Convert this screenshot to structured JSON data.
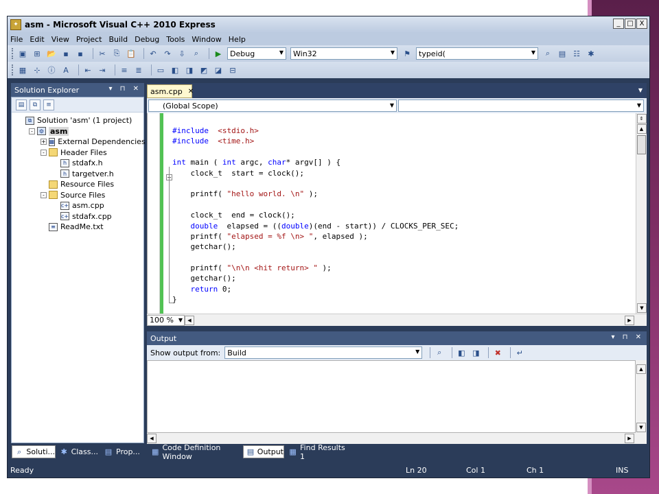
{
  "window": {
    "title": "asm - Microsoft Visual C++ 2010 Express",
    "controls": [
      "_",
      "□",
      "X"
    ]
  },
  "menu": [
    "File",
    "Edit",
    "View",
    "Project",
    "Build",
    "Debug",
    "Tools",
    "Window",
    "Help"
  ],
  "toolbar": {
    "config": "Debug",
    "platform": "Win32",
    "find_value": "typeid("
  },
  "solution_explorer": {
    "title": "Solution Explorer",
    "tree": [
      {
        "label": "Solution 'asm' (1 project)",
        "depth": 0,
        "icon": "solution-icon"
      },
      {
        "label": "asm",
        "depth": 1,
        "icon": "project-icon",
        "expander": "-",
        "bold": true
      },
      {
        "label": "External Dependencies",
        "depth": 2,
        "icon": "external-deps-icon",
        "expander": "+"
      },
      {
        "label": "Header Files",
        "depth": 2,
        "icon": "folder-icon",
        "expander": "-"
      },
      {
        "label": "stdafx.h",
        "depth": 3,
        "icon": "header-file-icon"
      },
      {
        "label": "targetver.h",
        "depth": 3,
        "icon": "header-file-icon"
      },
      {
        "label": "Resource Files",
        "depth": 2,
        "icon": "folder-icon"
      },
      {
        "label": "Source Files",
        "depth": 2,
        "icon": "folder-icon",
        "expander": "-"
      },
      {
        "label": "asm.cpp",
        "depth": 3,
        "icon": "cpp-file-icon"
      },
      {
        "label": "stdafx.cpp",
        "depth": 3,
        "icon": "cpp-file-icon"
      },
      {
        "label": "ReadMe.txt",
        "depth": 2,
        "icon": "text-file-icon"
      }
    ]
  },
  "editor": {
    "tab": "asm.cpp",
    "scope": "(Global Scope)",
    "zoom": "100 %",
    "code": [
      [
        {
          "t": "#include  ",
          "c": "kw"
        },
        {
          "t": "<stdio.h>",
          "c": "str"
        }
      ],
      [
        {
          "t": "#include  ",
          "c": "kw"
        },
        {
          "t": "<time.h>",
          "c": "str"
        }
      ],
      [
        {
          "t": "",
          "c": ""
        }
      ],
      [
        {
          "t": "int",
          "c": "kw"
        },
        {
          "t": " main ( ",
          "c": ""
        },
        {
          "t": "int",
          "c": "kw"
        },
        {
          "t": " argc, ",
          "c": ""
        },
        {
          "t": "char",
          "c": "kw"
        },
        {
          "t": "* argv[] ) {",
          "c": ""
        }
      ],
      [
        {
          "t": "    clock_t  start = clock();",
          "c": ""
        }
      ],
      [
        {
          "t": "",
          "c": ""
        }
      ],
      [
        {
          "t": "    printf( ",
          "c": ""
        },
        {
          "t": "\"hello world. \\n\"",
          "c": "str"
        },
        {
          "t": " );",
          "c": ""
        }
      ],
      [
        {
          "t": "",
          "c": ""
        }
      ],
      [
        {
          "t": "    clock_t  end = clock();",
          "c": ""
        }
      ],
      [
        {
          "t": "    ",
          "c": ""
        },
        {
          "t": "double",
          "c": "kw"
        },
        {
          "t": "  elapsed = ((",
          "c": ""
        },
        {
          "t": "double",
          "c": "kw"
        },
        {
          "t": ")(end - start)) / CLOCKS_PER_SEC;",
          "c": ""
        }
      ],
      [
        {
          "t": "    printf( ",
          "c": ""
        },
        {
          "t": "\"elapsed = %f \\n> \"",
          "c": "str"
        },
        {
          "t": ", elapsed );",
          "c": ""
        }
      ],
      [
        {
          "t": "    getchar();",
          "c": ""
        }
      ],
      [
        {
          "t": "",
          "c": ""
        }
      ],
      [
        {
          "t": "    printf( ",
          "c": ""
        },
        {
          "t": "\"\\n\\n <hit return> \"",
          "c": "str"
        },
        {
          "t": " );",
          "c": ""
        }
      ],
      [
        {
          "t": "    getchar();",
          "c": ""
        }
      ],
      [
        {
          "t": "    ",
          "c": ""
        },
        {
          "t": "return",
          "c": "kw"
        },
        {
          "t": " 0;",
          "c": ""
        }
      ],
      [
        {
          "t": "}",
          "c": ""
        }
      ]
    ]
  },
  "output": {
    "title": "Output",
    "show_from_label": "Show output from:",
    "source": "Build"
  },
  "bottom_tabs": [
    "Soluti...",
    "Class...",
    "Prop...",
    "Code Definition Window",
    "Output",
    "Find Results 1"
  ],
  "status": {
    "state": "Ready",
    "line": "Ln 20",
    "col": "Col 1",
    "ch": "Ch 1",
    "mode": "INS"
  }
}
